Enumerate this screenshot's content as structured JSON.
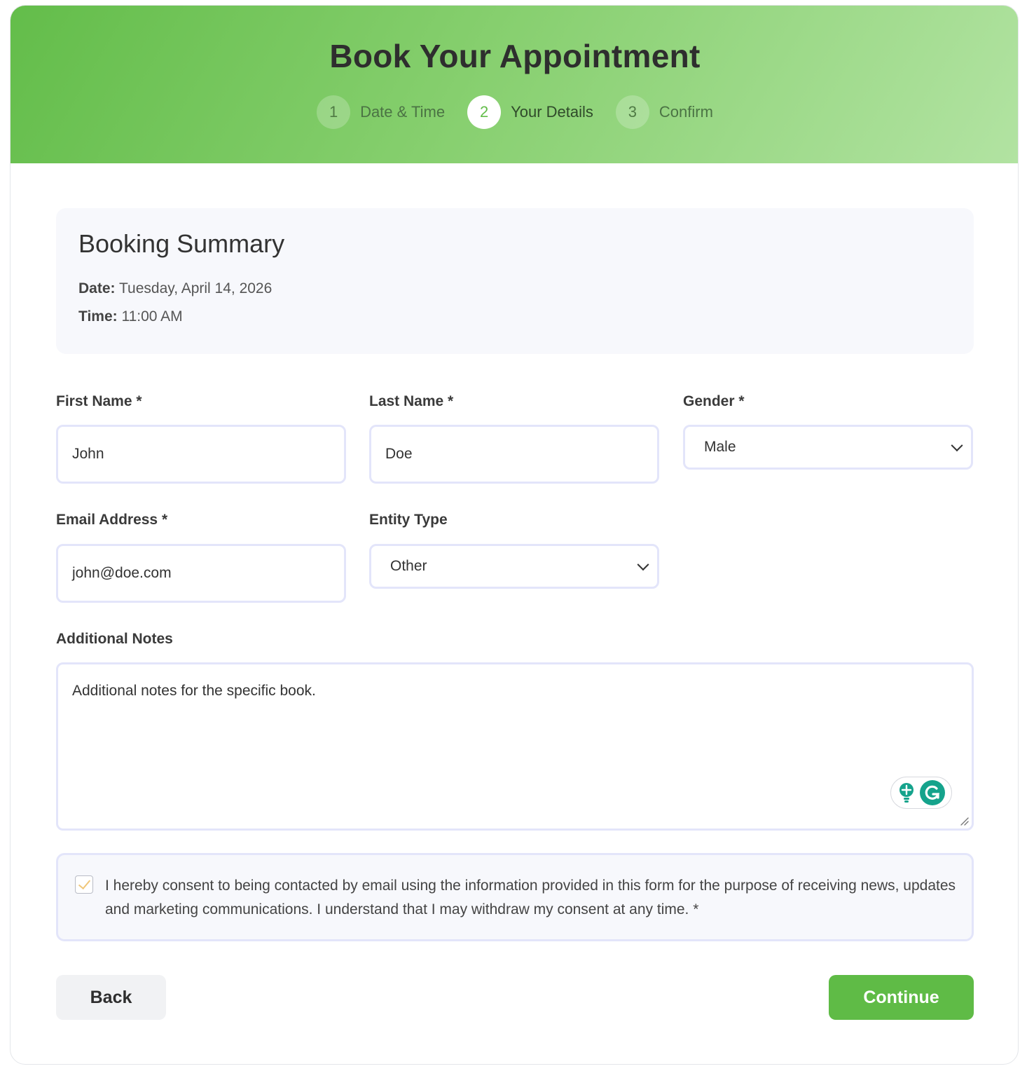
{
  "header": {
    "title": "Book Your Appointment",
    "steps": [
      {
        "number": "1",
        "label": "Date & Time",
        "active": false
      },
      {
        "number": "2",
        "label": "Your Details",
        "active": true
      },
      {
        "number": "3",
        "label": "Confirm",
        "active": false
      }
    ]
  },
  "summary": {
    "title": "Booking Summary",
    "date_label": "Date:",
    "date_value": "Tuesday, April 14, 2026",
    "time_label": "Time:",
    "time_value": "11:00 AM"
  },
  "form": {
    "first_name": {
      "label": "First Name *",
      "value": "John"
    },
    "last_name": {
      "label": "Last Name *",
      "value": "Doe"
    },
    "gender": {
      "label": "Gender *",
      "value": "Male"
    },
    "email": {
      "label": "Email Address *",
      "value": "john@doe.com"
    },
    "entity_type": {
      "label": "Entity Type",
      "value": "Other"
    },
    "notes": {
      "label": "Additional Notes",
      "value": "Additional notes for the specific book."
    },
    "consent": {
      "checked": true,
      "text": "I hereby consent to being contacted by email using the information provided in this form for the purpose of receiving news, updates and marketing communications. I understand that I may withdraw my consent at any time. *"
    }
  },
  "buttons": {
    "back": "Back",
    "continue": "Continue"
  },
  "colors": {
    "accent": "#5fbb46",
    "header_gradient_start": "#63bd4a",
    "header_gradient_end": "#b2e3a2",
    "field_border": "#e3e5fa",
    "summary_bg": "#f7f8fc"
  },
  "icons": {
    "select_chevron": "chevron-down-icon",
    "grammarly": "grammarly-icon",
    "suggestion": "lightbulb-icon",
    "checkbox": "checkmark-icon"
  }
}
